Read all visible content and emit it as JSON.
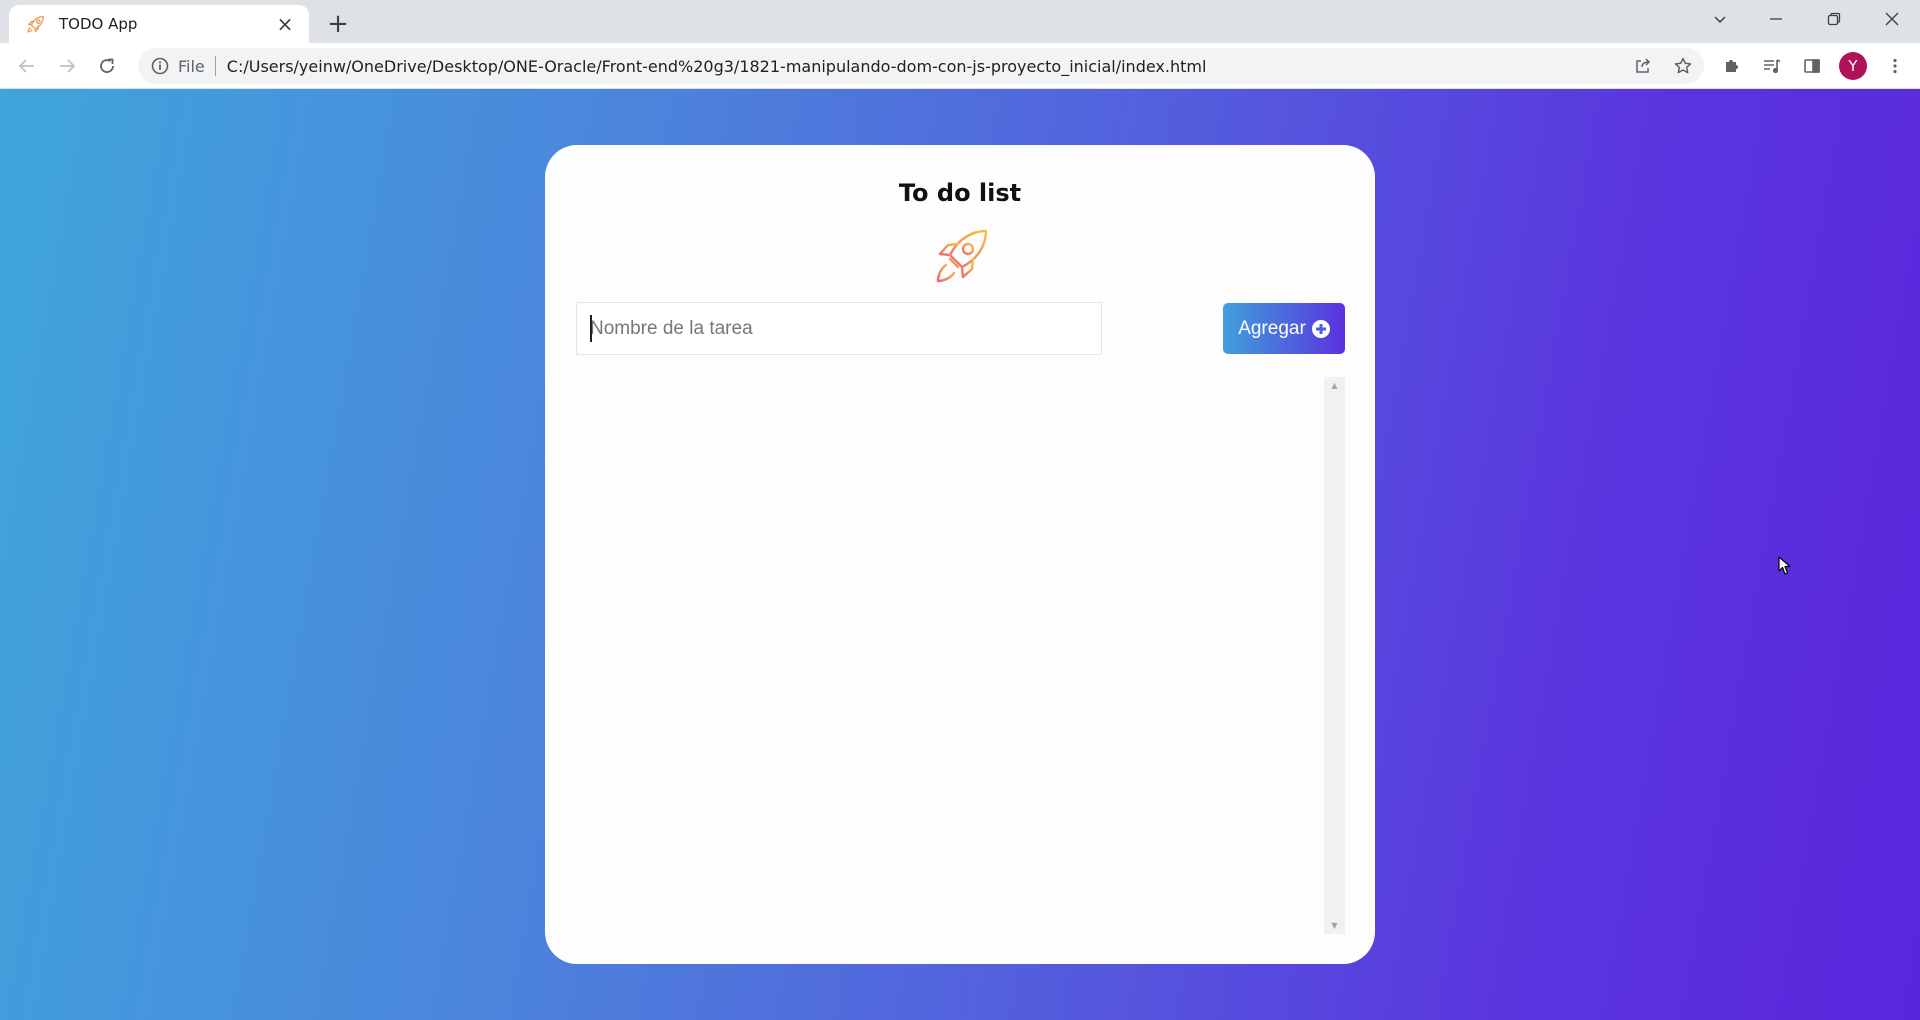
{
  "tab": {
    "title": "TODO App",
    "close": "×"
  },
  "newtab": "+",
  "toolbar": {
    "scheme": "File",
    "url": "C:/Users/yeinw/OneDrive/Desktop/ONE-Oracle/Front-end%20g3/1821-manipulando-dom-con-js-proyecto_inicial/index.html",
    "avatar": "Y"
  },
  "app": {
    "title": "To do list",
    "input_placeholder": "Nombre de la tarea",
    "add_label": "Agregar"
  },
  "colors": {
    "gradient_start": "#3fa5db",
    "gradient_end": "#5a26dd",
    "avatar": "#b0125b",
    "rocket_start": "#f6c244",
    "rocket_end": "#ec6a6f"
  }
}
